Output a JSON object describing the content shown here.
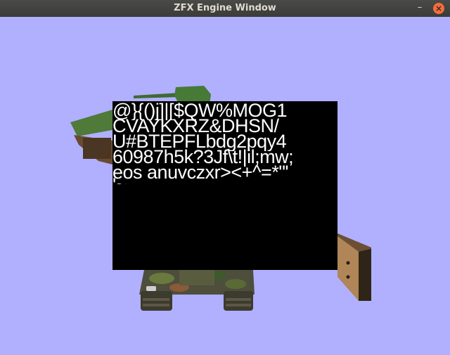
{
  "window": {
    "title": "ZFX Engine Window",
    "minimize_glyph": "–",
    "close_glyph": "×"
  },
  "scene": {
    "background_color": "#b0b0ff",
    "objects": [
      "tank-green",
      "tank-camo",
      "crate"
    ]
  },
  "font_texture": {
    "lines": [
      "@}{()j]|[$QW%MOG1",
      "CVAYKXRZ&DHSN/",
      "U#BTEPFLbdg2pqy4",
      "60987h5k?3Jf\\t!|il;mw;",
      "eos anuvczxr><+^=*\"'",
      "'~.-"
    ]
  }
}
